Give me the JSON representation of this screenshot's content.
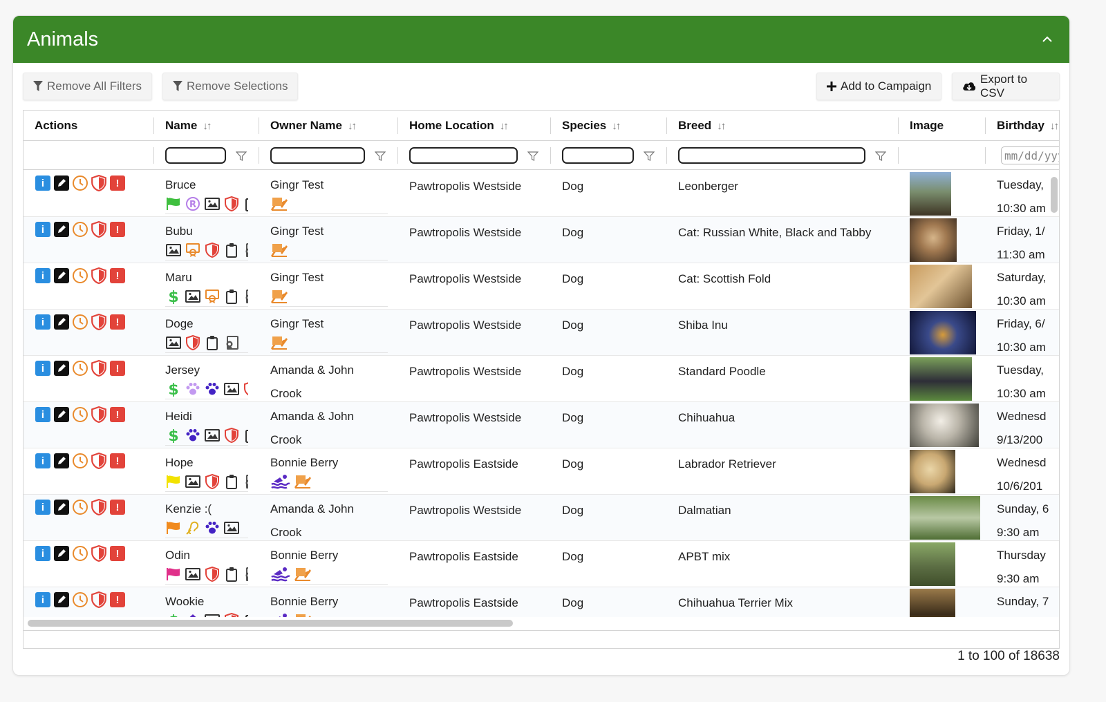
{
  "panel": {
    "title": "Animals"
  },
  "toolbar": {
    "remove_filters": "Remove All Filters",
    "remove_selections": "Remove Selections",
    "add_campaign": "Add to Campaign",
    "export_csv": "Export to CSV"
  },
  "columns": {
    "actions": "Actions",
    "name": "Name",
    "owner": "Owner Name",
    "location": "Home Location",
    "species": "Species",
    "breed": "Breed",
    "image": "Image",
    "birthday": "Birthday"
  },
  "filters": {
    "birthday_placeholder": "mm/dd/yyyy"
  },
  "colors": {
    "header_green": "#3b8728",
    "info_blue": "#2a8ee0",
    "alert_red": "#e2433a",
    "history_orange": "#e98a2c",
    "purple": "#5b2bc4"
  },
  "rows": [
    {
      "name": "Bruce",
      "owner": "Gingr Test",
      "owner2": "",
      "location": "Pawtropolis Westside",
      "species": "Dog",
      "breed": "Leonberger",
      "bday1": "Tuesday,",
      "bday2": "10:30 am",
      "badges": [
        "flag-green-icon",
        "registered-icon",
        "photo-icon",
        "shield-icon",
        "clipboard-icon"
      ],
      "owner_badges": [
        "signature-icon"
      ]
    },
    {
      "name": "Bubu",
      "owner": "Gingr Test",
      "owner2": "",
      "location": "Pawtropolis Westside",
      "species": "Dog",
      "breed": "Cat: Russian White, Black and Tabby",
      "bday1": "Friday, 1/",
      "bday2": "11:30 am",
      "badges": [
        "photo-icon",
        "certificate-icon",
        "shield-icon",
        "clipboard-icon",
        "certificate-gray-icon"
      ],
      "owner_badges": [
        "signature-icon"
      ]
    },
    {
      "name": "Maru",
      "owner": "Gingr Test",
      "owner2": "",
      "location": "Pawtropolis Westside",
      "species": "Dog",
      "breed": "Cat: Scottish Fold",
      "bday1": "Saturday,",
      "bday2": "10:30 am",
      "badges": [
        "dollar-icon",
        "photo-icon",
        "certificate-icon",
        "clipboard-icon",
        "certificate-gray-icon"
      ],
      "owner_badges": [
        "signature-icon"
      ]
    },
    {
      "name": "Doge",
      "owner": "Gingr Test",
      "owner2": "",
      "location": "Pawtropolis Westside",
      "species": "Dog",
      "breed": "Shiba Inu",
      "bday1": "Friday, 6/",
      "bday2": "10:30 am",
      "badges": [
        "photo-icon",
        "shield-icon",
        "clipboard-icon",
        "certificate-gray-icon"
      ],
      "owner_badges": [
        "signature-icon"
      ]
    },
    {
      "name": "Jersey",
      "owner": "Amanda & John",
      "owner2": "Crook",
      "location": "Pawtropolis Westside",
      "species": "Dog",
      "breed": "Standard Poodle",
      "bday1": "Tuesday,",
      "bday2": "10:30 am",
      "badges": [
        "dollar-icon",
        "paw-lavender-icon",
        "paw-purple-icon",
        "photo-icon",
        "shield-icon"
      ],
      "owner_badges": []
    },
    {
      "name": "Heidi",
      "owner": "Amanda & John",
      "owner2": "Crook",
      "location": "Pawtropolis Westside",
      "species": "Dog",
      "breed": "Chihuahua",
      "bday1": "Wednesd",
      "bday2": "9/13/200",
      "badges": [
        "dollar-icon",
        "paw-purple-icon",
        "photo-icon",
        "shield-icon",
        "clipboard-icon"
      ],
      "owner_badges": []
    },
    {
      "name": "Hope",
      "owner": "Bonnie Berry",
      "owner2": "",
      "location": "Pawtropolis Eastside",
      "species": "Dog",
      "breed": "Labrador Retriever",
      "bday1": "Wednesd",
      "bday2": "10/6/201",
      "badges": [
        "flag-yellow-icon",
        "photo-icon",
        "shield-icon",
        "clipboard-icon",
        "certificate-gray-icon"
      ],
      "owner_badges": [
        "swimmer-icon",
        "signature-icon"
      ]
    },
    {
      "name": "Kenzie :(",
      "owner": "Amanda & John",
      "owner2": "Crook",
      "location": "Pawtropolis Westside",
      "species": "Dog",
      "breed": "Dalmatian",
      "bday1": "Sunday, 6",
      "bday2": "9:30 am",
      "badges": [
        "flag-orange-icon",
        "hearing-icon",
        "paw-purple-icon",
        "photo-icon"
      ],
      "owner_badges": []
    },
    {
      "name": "Odin",
      "owner": "Bonnie Berry",
      "owner2": "",
      "location": "Pawtropolis Eastside",
      "species": "Dog",
      "breed": "APBT mix",
      "bday1": "Thursday",
      "bday2": "9:30 am",
      "badges": [
        "flag-pink-icon",
        "photo-icon",
        "shield-icon",
        "clipboard-icon",
        "certificate-gray-icon"
      ],
      "owner_badges": [
        "swimmer-icon",
        "signature-icon"
      ]
    },
    {
      "name": "Wookie",
      "owner": "Bonnie Berry",
      "owner2": "",
      "location": "Pawtropolis Eastside",
      "species": "Dog",
      "breed": "Chihuahua Terrier Mix",
      "bday1": "Sunday, 7",
      "bday2": "",
      "badges": [
        "dollar-icon",
        "house-icon",
        "photo-icon",
        "shield-icon",
        "clipboard-icon"
      ],
      "owner_badges": [
        "swimmer-icon",
        "signature-icon"
      ]
    }
  ],
  "pager": {
    "text": "1 to 100 of 18638"
  }
}
